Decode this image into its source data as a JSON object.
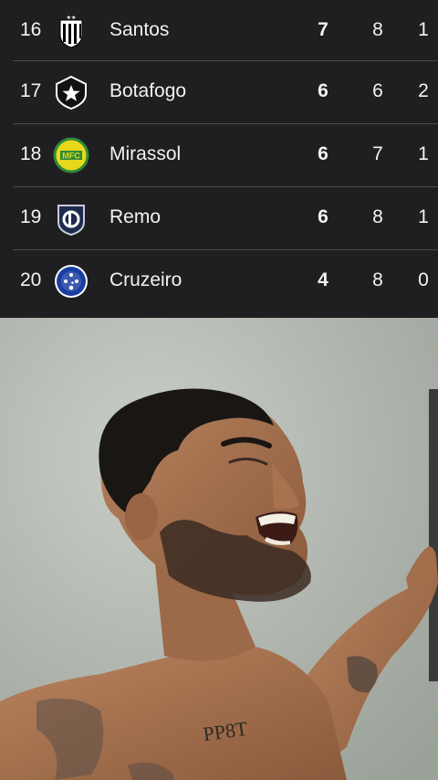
{
  "table": {
    "rows": [
      {
        "pos": "16",
        "team": "Santos",
        "pts": "7",
        "pj": "8",
        "v": "1",
        "crest": "santos-crest"
      },
      {
        "pos": "17",
        "team": "Botafogo",
        "pts": "6",
        "pj": "6",
        "v": "2",
        "crest": "botafogo-crest"
      },
      {
        "pos": "18",
        "team": "Mirassol",
        "pts": "6",
        "pj": "7",
        "v": "1",
        "crest": "mirassol-crest"
      },
      {
        "pos": "19",
        "team": "Remo",
        "pts": "6",
        "pj": "8",
        "v": "1",
        "crest": "remo-crest"
      },
      {
        "pos": "20",
        "team": "Cruzeiro",
        "pts": "4",
        "pj": "8",
        "v": "0",
        "crest": "cruzeiro-crest"
      }
    ],
    "colors": {
      "background": "#1f1f21",
      "divider": "#4a4a4c",
      "text": "#f2f2f2",
      "mirassol_yellow": "#e8d81c",
      "mirassol_green": "#2f8a3a",
      "cruzeiro_blue": "#1a3fa0",
      "remo_navy": "#1d2b4f"
    }
  },
  "photo": {
    "tattoo_text": "PP8T",
    "colors": {
      "wall": "#b7bdb6",
      "skin": "#a5724f",
      "hair": "#1a1614"
    }
  }
}
